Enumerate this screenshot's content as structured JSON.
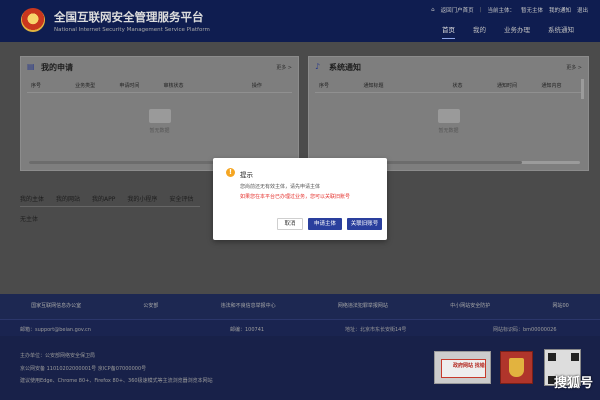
{
  "header": {
    "title": "全国互联网安全管理服务平台",
    "subtitle": "National Internet Security Management Service Platform",
    "top_links": {
      "back_home": "返回门户首页",
      "current_subject_label": "当前主体：",
      "current_subject_value": "暂无主体",
      "notifications": "我的通知",
      "logout": "退出"
    },
    "nav": [
      "首页",
      "我的",
      "业务办理",
      "系统通知"
    ]
  },
  "my_applications": {
    "title": "我的申请",
    "more": "更多 >",
    "columns": [
      "序号",
      "业务类型",
      "申请时间",
      "审核状态",
      "",
      "操作"
    ],
    "empty_text": "暂无数据"
  },
  "system_notices": {
    "title": "系统通知",
    "more": "更多 >",
    "columns": [
      "序号",
      "通知标题",
      "",
      "状态",
      "通知时间",
      "通知内容"
    ],
    "empty_text": "暂无数据"
  },
  "subtabs": {
    "items": [
      "我的主体",
      "我的网站",
      "我的APP",
      "我的小程序",
      "安全评估"
    ],
    "active_index": 0,
    "empty_text": "无主体"
  },
  "footer": {
    "links": [
      "国家互联网信息办公室",
      "公安部",
      "违法和不良信息举报中心",
      "网络违法犯罪举报网站",
      "中小网站安全防护",
      "网站00"
    ],
    "contact": {
      "email": "邮箱：support@beian.gov.cn",
      "zip": "邮编：100741",
      "address": "地址：北京市东长安街14号",
      "site_code": "网站标识码：bm00000026"
    },
    "lines": [
      "主办单位：公安部网络安全保卫局",
      "京公网安备 11010202000001号    京ICP备07000000号",
      "建议使用Edge、Chrome 80+、Firefox 80+、360极速模式等主流浏览器浏览本网站"
    ],
    "badge_text": "政府网站 找错",
    "watermark": "搜狐号"
  },
  "modal": {
    "title": "提示",
    "message": "您尚前还无有效主体，请先申请主体",
    "hint": "如果您在本平台已办理过业务，您可以关联旧账号",
    "buttons": {
      "cancel": "取消",
      "apply": "申请主体",
      "link_account": "关联旧账号"
    }
  },
  "colors": {
    "header_bg": "#1f3aa0",
    "primary_button": "#2a3f9d",
    "warning_icon": "#f5a623",
    "hint_text": "#e5302c"
  }
}
